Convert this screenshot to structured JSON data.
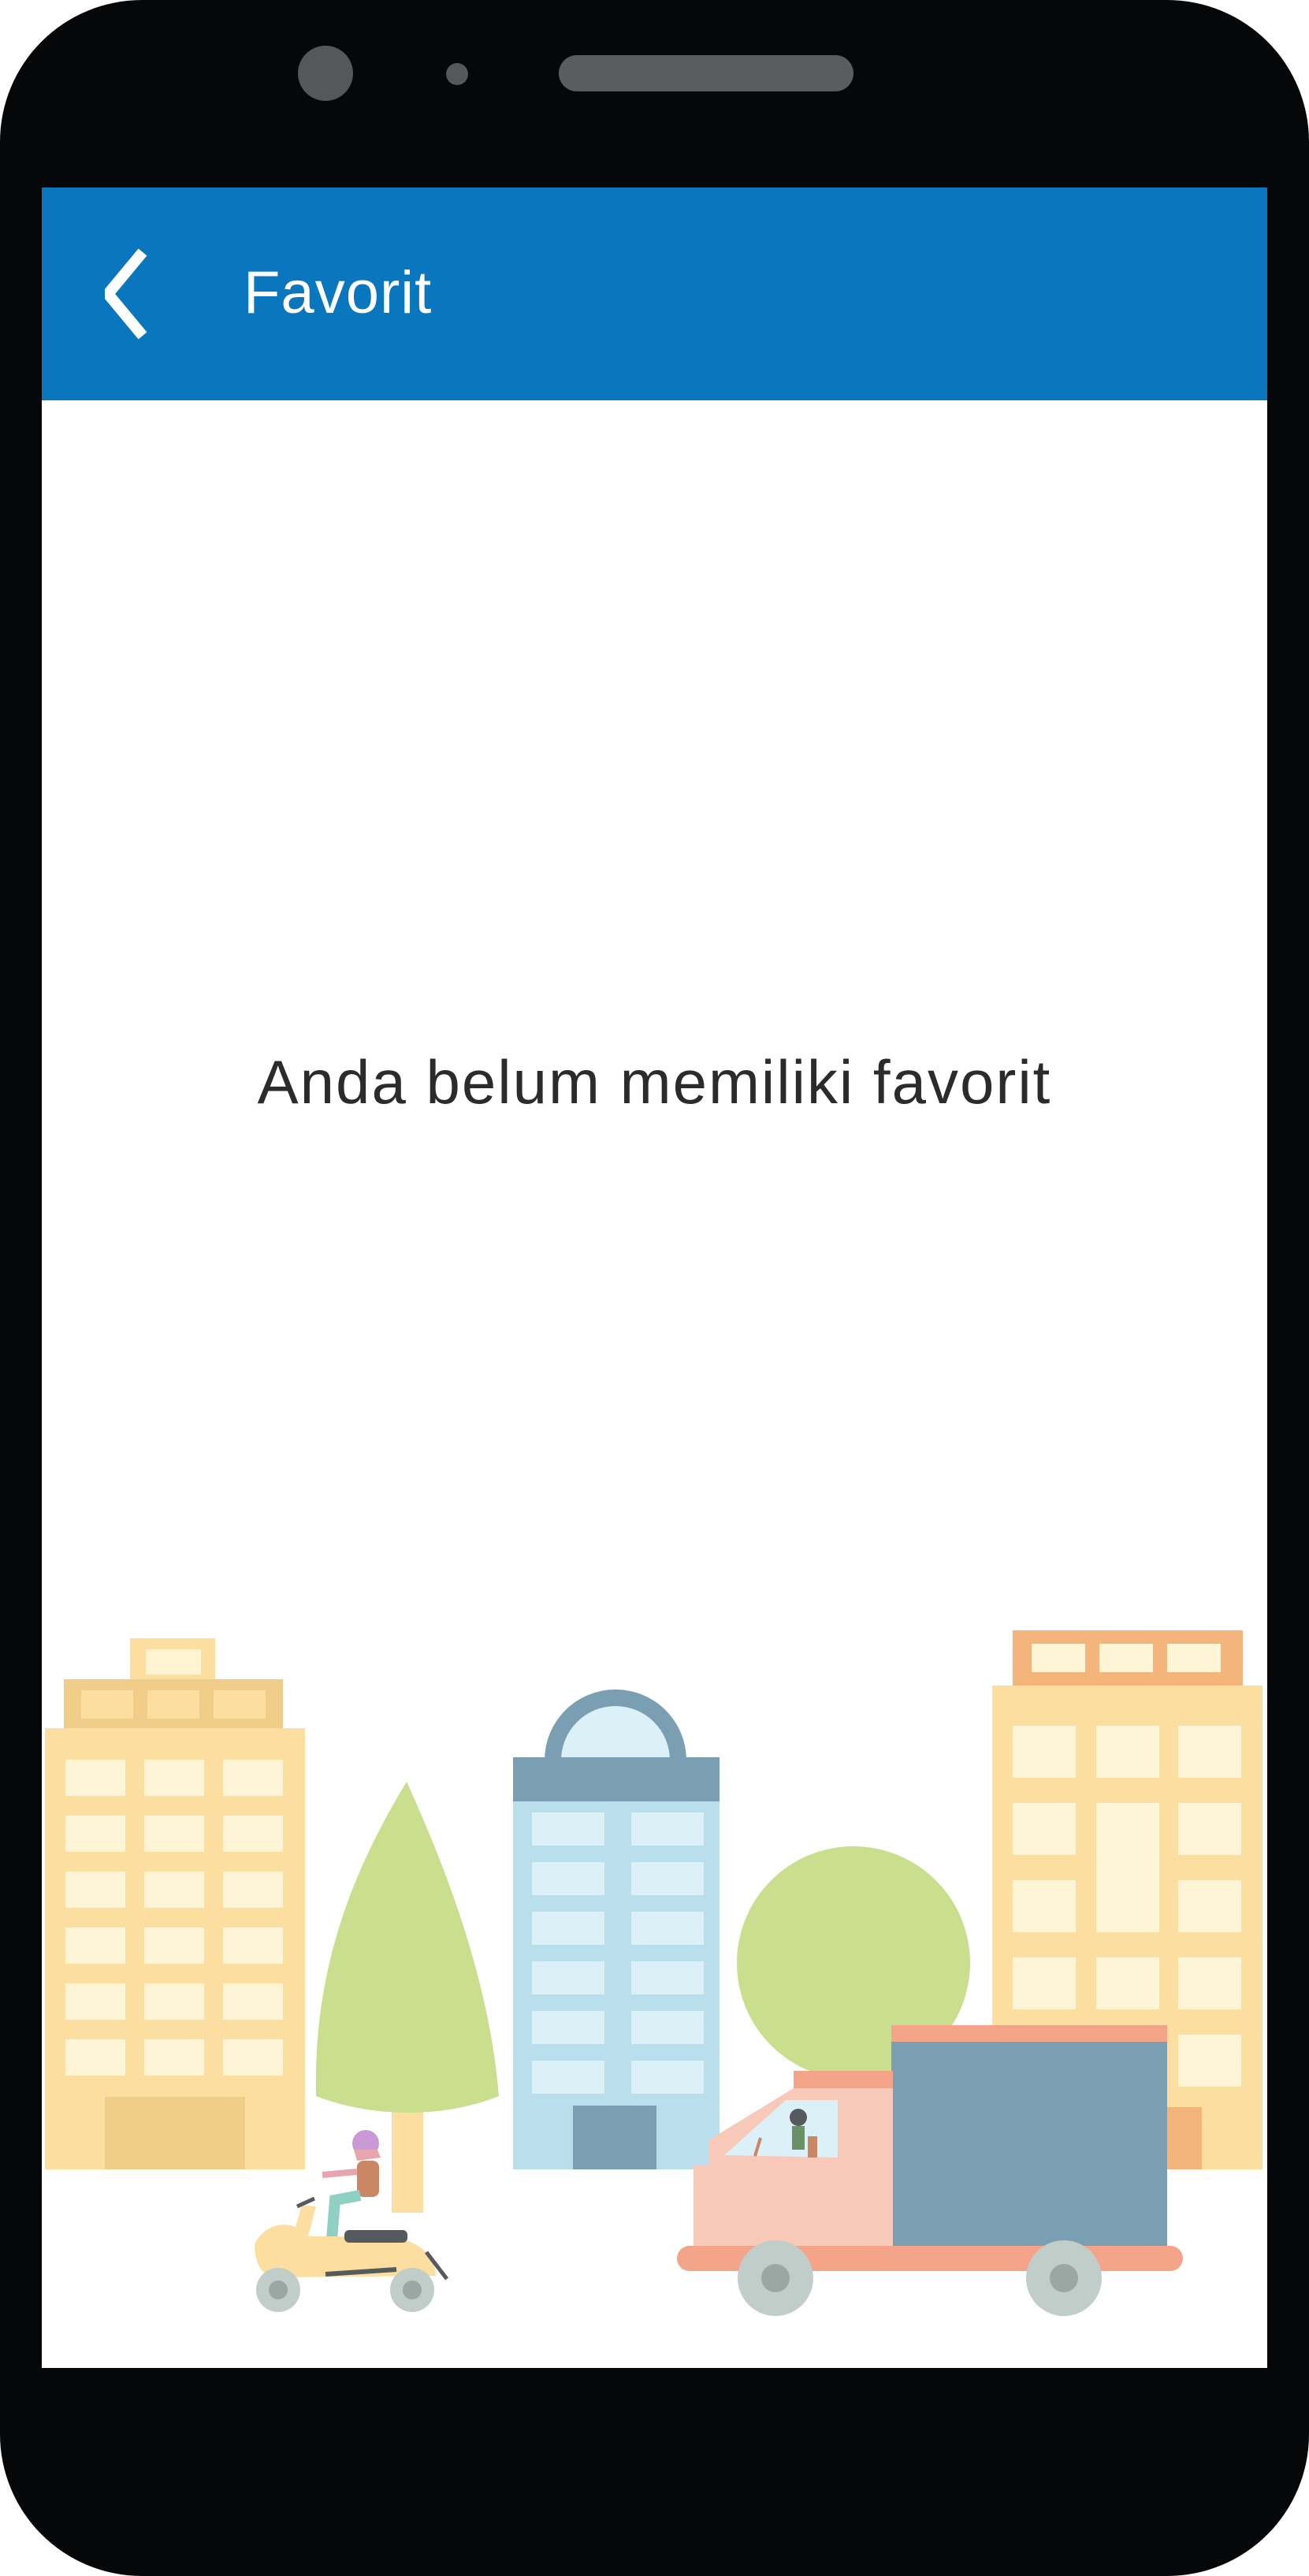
{
  "appbar": {
    "title": "Favorit",
    "back_icon": "chevron-left-icon",
    "color": "#0a76bd"
  },
  "empty_state": {
    "message": "Anda belum memiliki favorit",
    "illustration": "city-street-illustration"
  },
  "device": {
    "frame_color": "#050709",
    "screen_color": "#ffffff"
  }
}
